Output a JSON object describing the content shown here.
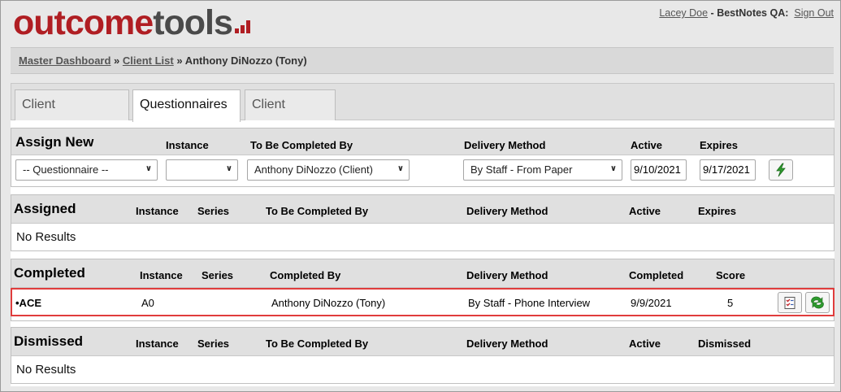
{
  "logo": {
    "part1": "outcome",
    "part2": "tools"
  },
  "userbar": {
    "user": "Lacey Doe",
    "separator": " - ",
    "org": "BestNotes QA:",
    "signout": "Sign Out"
  },
  "breadcrumb": {
    "master": "Master Dashboard",
    "sep1": " » ",
    "clients": "Client List",
    "sep2": " » ",
    "current": "Anthony DiNozzo (Tony)"
  },
  "tabs": [
    {
      "label": "Client Dashboard"
    },
    {
      "label": "Questionnaires"
    },
    {
      "label": "Client Details"
    }
  ],
  "assign": {
    "title": "Assign New",
    "col_instance": "Instance",
    "col_completed_by": "To Be Completed By",
    "col_delivery": "Delivery Method",
    "col_active": "Active",
    "col_expires": "Expires",
    "questionnaire_value": "-- Questionnaire --",
    "instance_value": "",
    "completed_by_value": "Anthony DiNozzo (Client)",
    "delivery_value": "By Staff - From Paper",
    "active_value": "9/10/2021",
    "expires_value": "9/17/2021"
  },
  "assigned": {
    "title": "Assigned",
    "col_instance": "Instance",
    "col_series": "Series",
    "col_completed_by": "To Be Completed By",
    "col_delivery": "Delivery Method",
    "col_active": "Active",
    "col_expires": "Expires",
    "empty": "No Results"
  },
  "completed": {
    "title": "Completed",
    "col_instance": "Instance",
    "col_series": "Series",
    "col_completed_by": "Completed By",
    "col_delivery": "Delivery Method",
    "col_completed": "Completed",
    "col_score": "Score",
    "rows": [
      {
        "name": "•ACE",
        "instance": "A0",
        "series": "",
        "completed_by": "Anthony DiNozzo (Tony)",
        "delivery": "By Staff - Phone Interview",
        "completed": "9/9/2021",
        "score": "5"
      }
    ]
  },
  "dismissed": {
    "title": "Dismissed",
    "col_instance": "Instance",
    "col_series": "Series",
    "col_completed_by": "To Be Completed By",
    "col_delivery": "Delivery Method",
    "col_active": "Active",
    "col_dismissed": "Dismissed",
    "empty": "No Results"
  },
  "colors": {
    "brand_red": "#b01e23",
    "logo_gray": "#4a4a4a",
    "highlight_border": "#e03c3c",
    "bolt_green": "#2e9b2e"
  }
}
